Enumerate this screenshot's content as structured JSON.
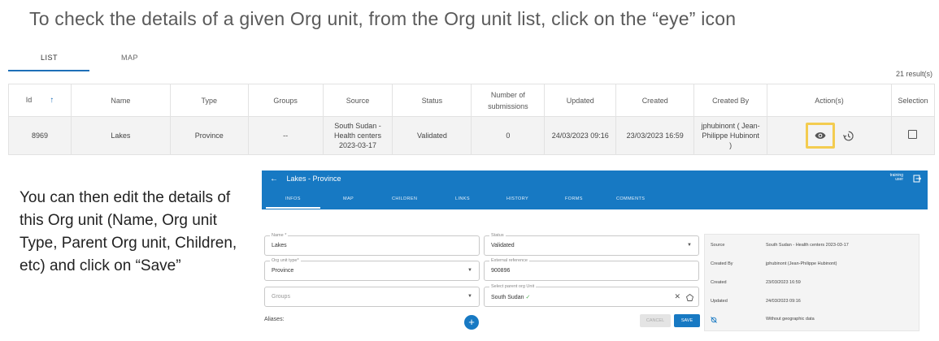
{
  "headline": "To check the details of a given Org unit, from the Org unit list, click on the “eye” icon",
  "tabs": [
    {
      "label": "LIST"
    },
    {
      "label": "MAP"
    }
  ],
  "results_count": "21 result(s)",
  "table": {
    "headers": [
      "Id",
      "Name",
      "Type",
      "Groups",
      "Source",
      "Status",
      "Number of submissions",
      "Updated",
      "Created",
      "Created By",
      "Action(s)",
      "Selection"
    ],
    "row": {
      "id": "8969",
      "name": "Lakes",
      "type": "Province",
      "groups": "--",
      "source_line1": "South Sudan -",
      "source_line2": "Health centers",
      "source_line3": "2023-03-17",
      "status": "Validated",
      "submissions": "0",
      "updated": "24/03/2023 09:16",
      "created": "23/03/2023 16:59",
      "created_by_line1": "jphubinont ( Jean-",
      "created_by_line2": "Philippe Hubinont",
      "created_by_line3": ")"
    }
  },
  "note": "You can then edit the details of this Org unit (Name, Org unit Type, Parent Org unit, Children, etc) and click on “Save”",
  "panel": {
    "title": "Lakes - Province",
    "env_line1": "training",
    "env_line2": "user",
    "tabs": [
      "INFOS",
      "MAP",
      "CHILDREN",
      "LINKS",
      "HISTORY",
      "FORMS",
      "COMMENTS"
    ],
    "fields": {
      "name_label": "Name *",
      "name_value": "Lakes",
      "type_label": "Org unit type*",
      "type_value": "Province",
      "groups_placeholder": "Groups",
      "status_label": "Status",
      "status_value": "Validated",
      "extref_label": "External reference",
      "extref_value": "900896",
      "parent_label": "Select parent org Unit",
      "parent_value": "South Sudan"
    },
    "info": [
      {
        "k": "Source",
        "v": "South Sudan - Health centers 2023-03-17"
      },
      {
        "k": "Created By",
        "v": "jphubinont (Jean-Philippe Hubinont)"
      },
      {
        "k": "Created",
        "v": "23/03/2023 16:59"
      },
      {
        "k": "Updated",
        "v": "24/03/2023 09:16"
      },
      {
        "k": "",
        "v": "Without geographic data"
      }
    ],
    "aliases_label": "Aliases:",
    "cancel_label": "CANCEL",
    "save_label": "SAVE"
  },
  "colors": {
    "primary": "#1779c3",
    "highlight": "#f3cc50"
  }
}
